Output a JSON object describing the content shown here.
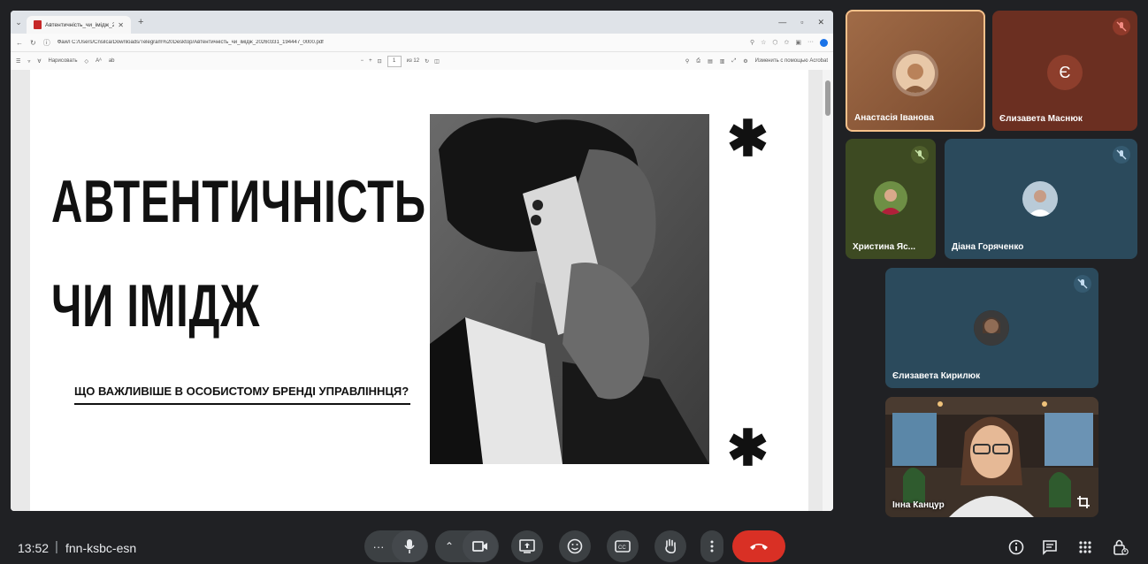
{
  "browser": {
    "tab_title": "Автентичність_чи_імідж_20260...",
    "url": "Файл  C:/Users/Cnsilca/Downloads/Telegram%20Desktop/Автентичність_чи_імідж_20260331_194447_0000.pdf",
    "pdf_toolbar": {
      "draw_label": "Нарисовать",
      "page_current": "1",
      "page_total": "из 12",
      "acrobat_label": "Изменить с помощью Acrobat"
    }
  },
  "slide": {
    "title_line1": "АВТЕНТИЧНІСТЬ",
    "title_line2": "ЧИ ІМІДЖ",
    "subtitle": "ЩО ВАЖЛИВІШЕ В ОСОБИСТОМУ  БРЕНДІ УПРАВЛІННЦЯ?"
  },
  "participants": [
    {
      "name": "Анастасія Іванова",
      "muted": false,
      "active_speaker": true
    },
    {
      "name": "Єлизавета Маснюк",
      "initial": "Є",
      "muted": true
    },
    {
      "name": "Христина Яс...",
      "muted": true
    },
    {
      "name": "Діана Горяченко",
      "muted": true
    },
    {
      "name": "Єлизавета Кирилюк",
      "muted": true
    },
    {
      "name": "Інна Канцур",
      "muted": false
    }
  ],
  "meeting": {
    "time": "13:52",
    "separator": "|",
    "code": "fnn-ksbc-esn"
  },
  "colors": {
    "background": "#202124",
    "end_call": "#d93025",
    "active_border": "#f6c08a"
  }
}
